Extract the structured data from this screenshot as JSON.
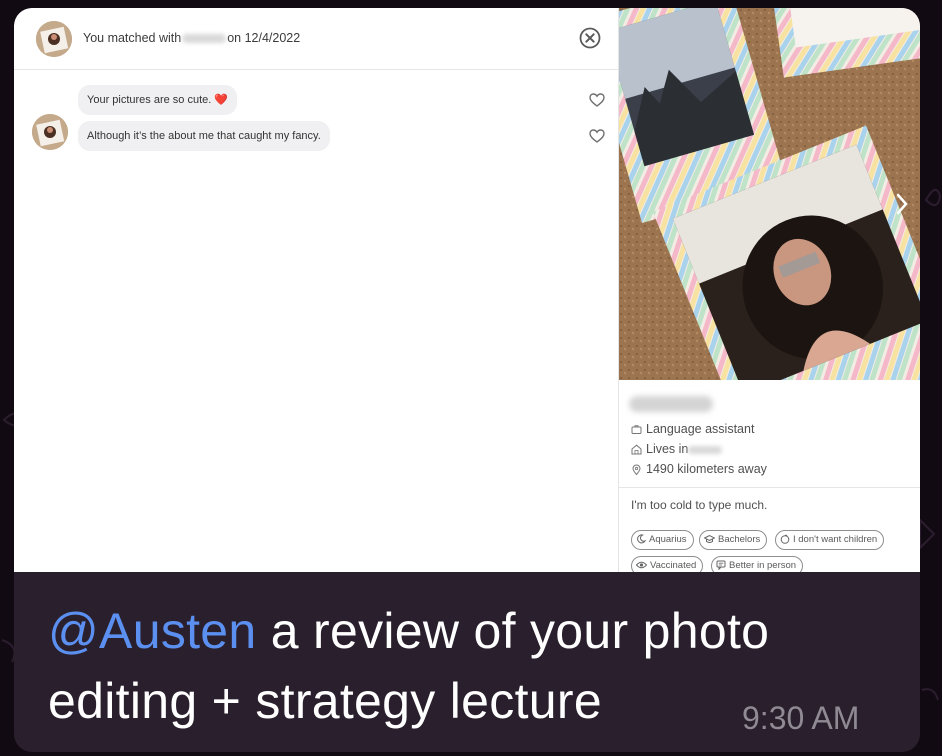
{
  "chat": {
    "header": {
      "match_prefix": "You matched with",
      "match_date": "on 12/4/2022"
    },
    "messages": [
      {
        "text": "Your pictures are so cute. ❤️",
        "liked": false
      },
      {
        "text": "Although it’s the about me that caught my fancy.",
        "liked": false
      }
    ],
    "icons": {
      "close": "close-circle-icon",
      "like": "heart-outline-icon"
    }
  },
  "profile": {
    "job": "Language assistant",
    "lives_prefix": "Lives in",
    "distance": "1490 kilometers away",
    "bio": "I'm too cold to type much.",
    "tags": [
      {
        "label": "Aquarius",
        "icon": "moon-icon"
      },
      {
        "label": "Bachelors",
        "icon": "graduation-cap-icon"
      },
      {
        "label": "I don't want children",
        "icon": "baby-icon"
      },
      {
        "label": "Vaccinated",
        "icon": "eye-icon"
      },
      {
        "label": "Better in person",
        "icon": "chat-icon"
      }
    ]
  },
  "caption": {
    "mention": "@Austen",
    "text": " a review of your photo editing + strategy lecture",
    "time": "9:30 AM"
  },
  "colors": {
    "mention": "#5b90f0",
    "bubble": "#2a1f2c",
    "heart": "#d0243a"
  }
}
